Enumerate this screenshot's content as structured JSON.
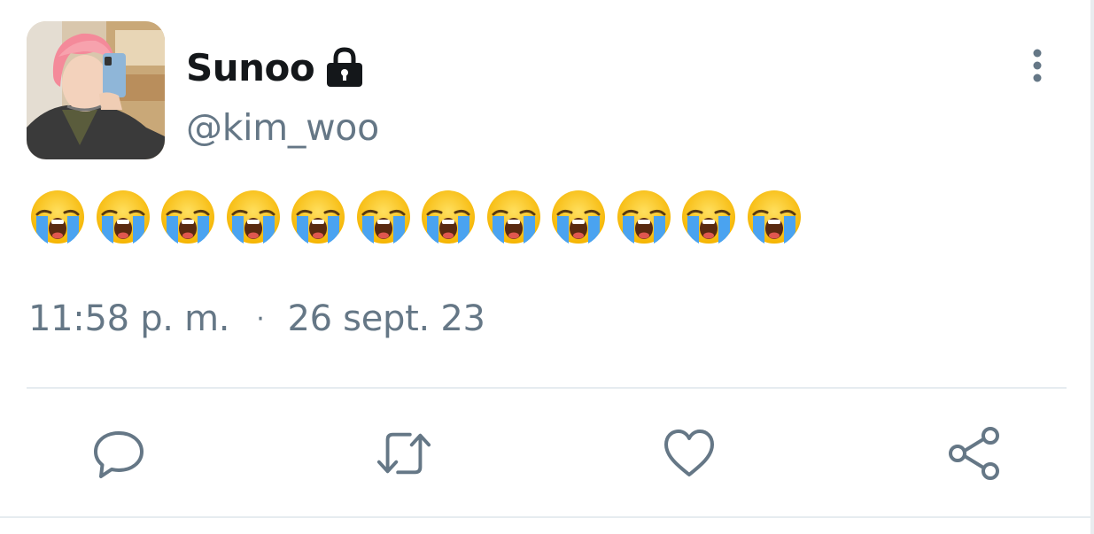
{
  "tweet": {
    "display_name": "Sunoo",
    "handle": "@kim_woo",
    "protected_icon": "lock-icon",
    "more_icon": "more-vertical-icon",
    "text_emojis": [
      "crying",
      "crying",
      "crying",
      "crying",
      "crying",
      "crying",
      "crying",
      "crying",
      "crying",
      "crying",
      "crying",
      "crying"
    ],
    "emoji_name": "loudly-crying-face",
    "time": "11:58 p. m.",
    "separator": "·",
    "date": "26 sept. 23"
  },
  "actions": [
    {
      "name": "reply",
      "icon": "reply-bubble-icon"
    },
    {
      "name": "retweet",
      "icon": "retweet-icon"
    },
    {
      "name": "like",
      "icon": "heart-icon"
    },
    {
      "name": "share",
      "icon": "share-icon"
    }
  ],
  "colors": {
    "text_primary": "#14171a",
    "text_secondary": "#657786",
    "icon_gray": "#657786",
    "divider": "#e6ecf0"
  }
}
